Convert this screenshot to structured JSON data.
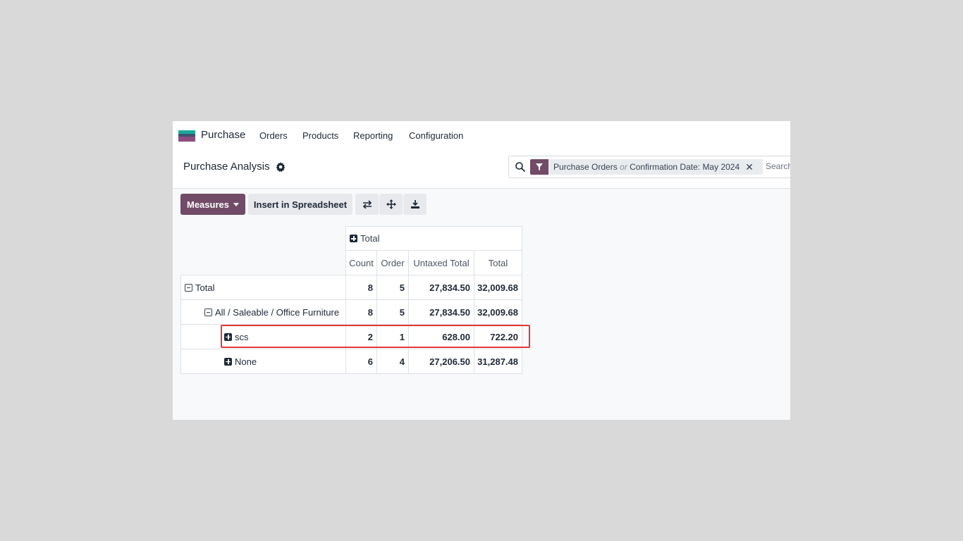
{
  "navbar": {
    "app_name": "Purchase",
    "menu": [
      "Orders",
      "Products",
      "Reporting",
      "Configuration"
    ]
  },
  "control_panel": {
    "title": "Purchase Analysis",
    "search": {
      "facet_part1": "Purchase Orders",
      "facet_or": "or",
      "facet_part2": "Confirmation Date: May 2024",
      "placeholder": "Search..."
    }
  },
  "toolbar": {
    "measures_label": "Measures",
    "spreadsheet_label": "Insert in Spreadsheet",
    "icons": [
      "flip-axis-icon",
      "expand-all-icon",
      "download-icon"
    ]
  },
  "pivot": {
    "col_group": "Total",
    "measures": [
      "Count",
      "Order",
      "Untaxed Total",
      "Total"
    ],
    "rows": [
      {
        "label": "Total",
        "values": [
          "8",
          "5",
          "27,834.50",
          "32,009.68"
        ]
      },
      {
        "label": "All / Saleable / Office Furniture",
        "values": [
          "8",
          "5",
          "27,834.50",
          "32,009.68"
        ]
      },
      {
        "label": "scs",
        "values": [
          "2",
          "1",
          "628.00",
          "722.20"
        ]
      },
      {
        "label": "None",
        "values": [
          "6",
          "4",
          "27,206.50",
          "31,287.48"
        ]
      }
    ]
  },
  "colors": {
    "brand": "#714b67",
    "highlight": "#e53935"
  }
}
